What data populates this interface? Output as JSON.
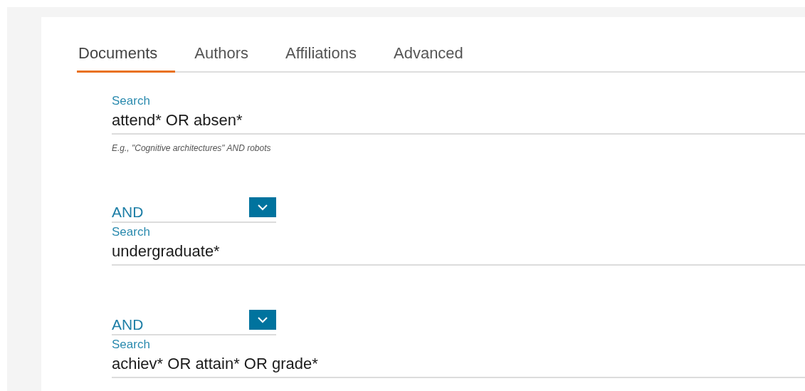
{
  "tabs": [
    {
      "label": "Documents",
      "selected": true
    },
    {
      "label": "Authors",
      "selected": false
    },
    {
      "label": "Affiliations",
      "selected": false
    },
    {
      "label": "Advanced",
      "selected": false
    }
  ],
  "search_rows": [
    {
      "label": "Search",
      "value": "attend* OR absen*",
      "hint": "E.g., \"Cognitive architectures\" AND robots"
    },
    {
      "operator": "AND",
      "label": "Search",
      "value": "undergraduate*"
    },
    {
      "operator": "AND",
      "label": "Search",
      "value": "achiev* OR attain* OR grade*"
    }
  ]
}
